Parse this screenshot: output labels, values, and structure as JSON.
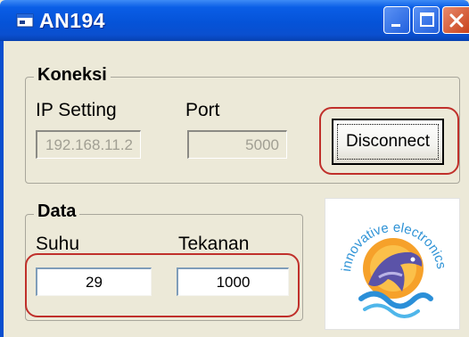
{
  "window": {
    "title": "AN194"
  },
  "title_buttons": {
    "minimize": "minimize-icon",
    "maximize": "maximize-icon",
    "close": "close-icon"
  },
  "koneksi": {
    "legend": "Koneksi",
    "ip_label": "IP Setting",
    "ip_value": "192.168.11.2",
    "port_label": "Port",
    "port_value": "5000",
    "disconnect_label": "Disconnect"
  },
  "data": {
    "legend": "Data",
    "suhu_label": "Suhu",
    "suhu_value": "29",
    "tekanan_label": "Tekanan",
    "tekanan_value": "1000"
  },
  "logo": {
    "text": "innovative electronics",
    "icon": "dolphin-logo"
  },
  "colors": {
    "titlebar": "#0553d8",
    "window_bg": "#ece9d8",
    "highlight": "#c0302b",
    "close": "#c8421c"
  }
}
